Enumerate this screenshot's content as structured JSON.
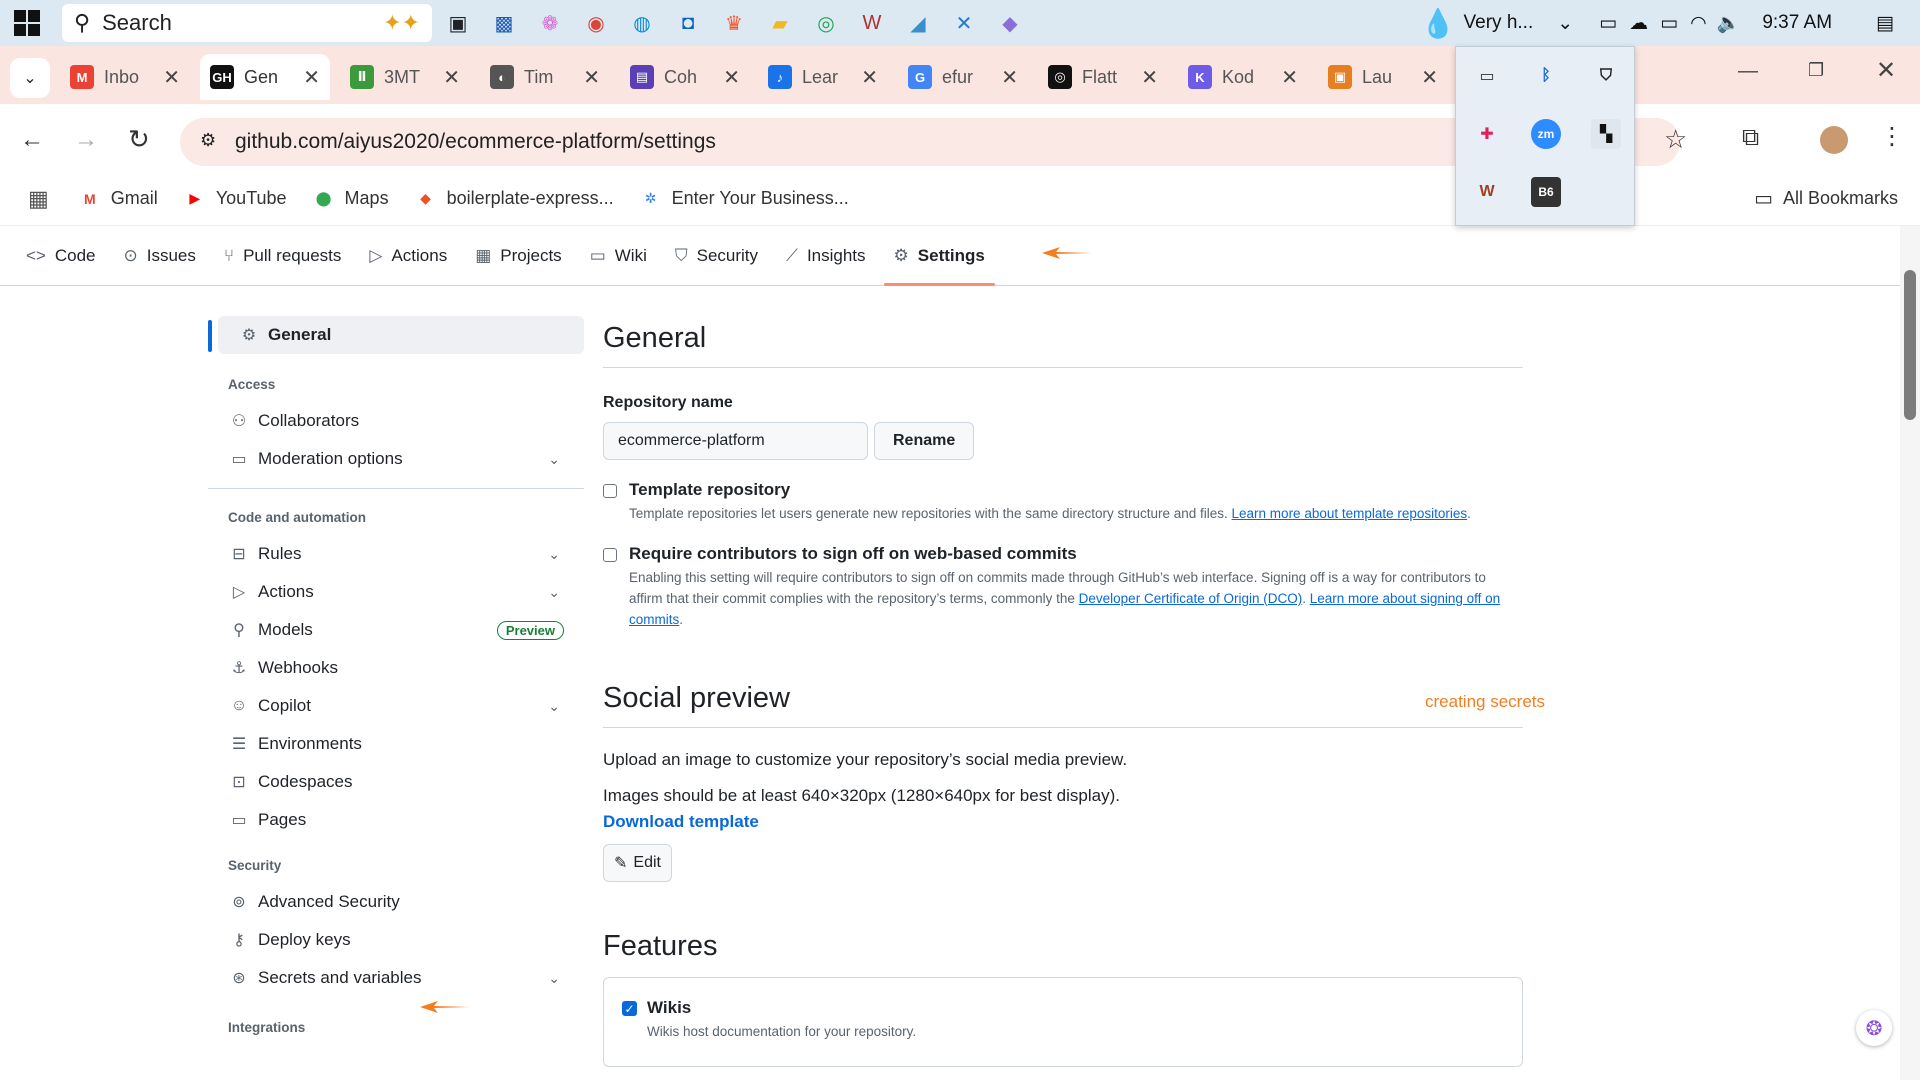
{
  "taskbar": {
    "search_placeholder": "Search",
    "weather": "Very h...",
    "time": "9:37 AM"
  },
  "tabs": [
    {
      "label": "Inbo",
      "fav": "M",
      "color": "#ea4335"
    },
    {
      "label": "Gen",
      "fav": "GH",
      "color": "#111111"
    },
    {
      "label": "3MT",
      "fav": "Ⅱ",
      "color": "#3c9a3c"
    },
    {
      "label": "Tim",
      "fav": "◐",
      "color": "#555555"
    },
    {
      "label": "Coh",
      "fav": "▤",
      "color": "#5b3fb5"
    },
    {
      "label": "Lear",
      "fav": "♪",
      "color": "#1a73e8"
    },
    {
      "label": "efur",
      "fav": "G",
      "color": "#4285f4"
    },
    {
      "label": "Flatt",
      "fav": "◎",
      "color": "#111111"
    },
    {
      "label": "Kod",
      "fav": "K",
      "color": "#6c5ce7"
    },
    {
      "label": "Lau",
      "fav": "▣",
      "color": "#e67e22"
    }
  ],
  "address": {
    "url": "github.com/aiyus2020/ecommerce-platform/settings"
  },
  "bookmarks": [
    {
      "label": "Gmail",
      "icon": "M",
      "color": "#ea4335"
    },
    {
      "label": "YouTube",
      "icon": "▶",
      "color": "#ff0000"
    },
    {
      "label": "Maps",
      "icon": "⬤",
      "color": "#34a853"
    },
    {
      "label": "boilerplate-express...",
      "icon": "◆",
      "color": "#f25022"
    },
    {
      "label": "Enter Your Business...",
      "icon": "✲",
      "color": "#2f80ed"
    }
  ],
  "all_bookmarks": "All Bookmarks",
  "repo_nav": [
    {
      "label": "Code",
      "icon": "<>"
    },
    {
      "label": "Issues",
      "icon": "⊙"
    },
    {
      "label": "Pull requests",
      "icon": "⑂"
    },
    {
      "label": "Actions",
      "icon": "▷"
    },
    {
      "label": "Projects",
      "icon": "▦"
    },
    {
      "label": "Wiki",
      "icon": "▭"
    },
    {
      "label": "Security",
      "icon": "⛉"
    },
    {
      "label": "Insights",
      "icon": "⟋"
    },
    {
      "label": "Settings",
      "icon": "⚙"
    }
  ],
  "sidebar": {
    "general": "General",
    "access_heading": "Access",
    "collaborators": "Collaborators",
    "moderation": "Moderation options",
    "code_heading": "Code and automation",
    "rules": "Rules",
    "actions": "Actions",
    "models": "Models",
    "preview_badge": "Preview",
    "webhooks": "Webhooks",
    "copilot": "Copilot",
    "environments": "Environments",
    "codespaces": "Codespaces",
    "pages": "Pages",
    "security_heading": "Security",
    "advanced_security": "Advanced Security",
    "deploy_keys": "Deploy keys",
    "secrets": "Secrets and variables",
    "integrations_heading": "Integrations"
  },
  "main": {
    "general_title": "General",
    "repo_name_label": "Repository name",
    "repo_name_value": "ecommerce-platform",
    "rename_button": "Rename",
    "template_title": "Template repository",
    "template_desc": "Template repositories let users generate new repositories with the same directory structure and files. ",
    "template_link": "Learn more about template repositories",
    "signoff_title": "Require contributors to sign off on web-based commits",
    "signoff_desc1": "Enabling this setting will require contributors to sign off on commits made through GitHub’s web interface. Signing off is a way for contributors to affirm that their commit complies with the repository’s terms, commonly the ",
    "signoff_link1": "Developer Certificate of Origin (DCO)",
    "signoff_link2": "Learn more about signing off on commits",
    "social_title": "Social preview",
    "creating_secrets": "creating secrets",
    "social_p1": "Upload an image to customize your repository’s social media preview.",
    "social_p2": "Images should be at least 640×320px (1280×640px for best display).",
    "download_template": "Download template",
    "edit_button": "Edit",
    "features_title": "Features",
    "wikis_label": "Wikis",
    "wikis_desc": "Wikis host documentation for your repository."
  }
}
